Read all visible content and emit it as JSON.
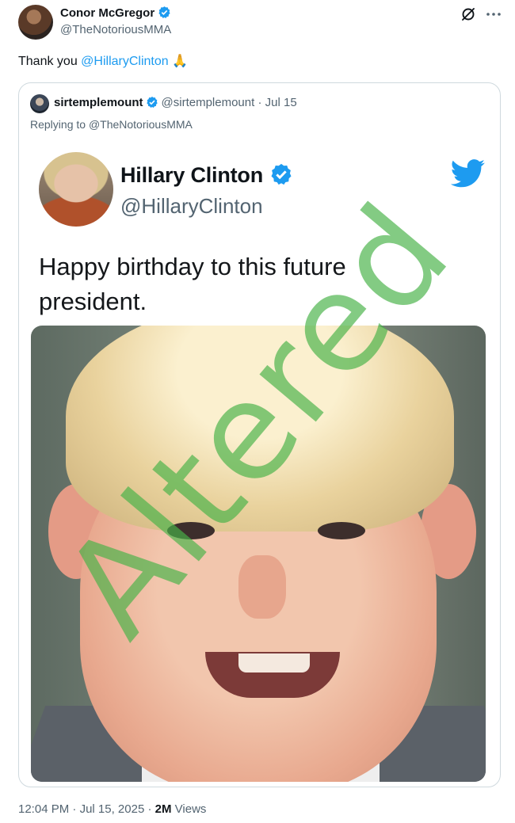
{
  "author": {
    "name": "Conor McGregor",
    "handle": "@TheNotoriousMMA"
  },
  "header_icons": [
    "grok-icon",
    "more-icon"
  ],
  "tweet": {
    "text_prefix": "Thank you ",
    "mention": "@HillaryClinton",
    "emoji": "🙏"
  },
  "quoted": {
    "name": "sirtemplemount",
    "handle": "@sirtemplemount",
    "separator": "·",
    "date": "Jul 15",
    "replying_label": "Replying to",
    "replying_to": "@TheNotoriousMMA",
    "embedded": {
      "name": "Hillary Clinton",
      "handle": "@HillaryClinton",
      "text_line1": "Happy birthday to this future",
      "text_line2": "president."
    }
  },
  "watermark": "Altered",
  "footer": {
    "time": "12:04 PM",
    "separator": "·",
    "date": "Jul 15, 2025",
    "separator2": "·",
    "views": "2M",
    "views_label": "Views"
  },
  "colors": {
    "accent": "#1d9bf0",
    "muted": "#536471",
    "watermark": "#48b248"
  }
}
